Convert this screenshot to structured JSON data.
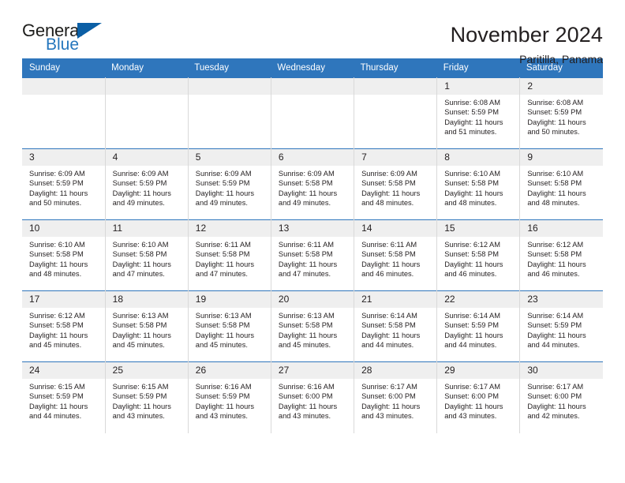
{
  "brand": {
    "name_part1": "General",
    "name_part2": "Blue",
    "triangle_color": "#0b5fa5",
    "blue_color": "#2476bd"
  },
  "header": {
    "title": "November 2024",
    "subtitle": "Paritilla, Panama"
  },
  "theme": {
    "header_bg": "#2f76bc",
    "daynum_bg": "#efefef",
    "text": "#231f20",
    "grid_line": "#d9d9d9"
  },
  "labels": {
    "sunrise_prefix": "Sunrise:",
    "sunset_prefix": "Sunset:",
    "daylight_prefix": "Daylight:"
  },
  "weekday_headers": [
    "Sunday",
    "Monday",
    "Tuesday",
    "Wednesday",
    "Thursday",
    "Friday",
    "Saturday"
  ],
  "weeks": [
    [
      {
        "day": "",
        "sunrise": "",
        "sunset": "",
        "daylight_line1": "",
        "daylight_line2": "",
        "empty": true
      },
      {
        "day": "",
        "sunrise": "",
        "sunset": "",
        "daylight_line1": "",
        "daylight_line2": "",
        "empty": true
      },
      {
        "day": "",
        "sunrise": "",
        "sunset": "",
        "daylight_line1": "",
        "daylight_line2": "",
        "empty": true
      },
      {
        "day": "",
        "sunrise": "",
        "sunset": "",
        "daylight_line1": "",
        "daylight_line2": "",
        "empty": true
      },
      {
        "day": "",
        "sunrise": "",
        "sunset": "",
        "daylight_line1": "",
        "daylight_line2": "",
        "empty": true
      },
      {
        "day": "1",
        "sunrise": "Sunrise: 6:08 AM",
        "sunset": "Sunset: 5:59 PM",
        "daylight_line1": "Daylight: 11 hours",
        "daylight_line2": "and 51 minutes.",
        "empty": false
      },
      {
        "day": "2",
        "sunrise": "Sunrise: 6:08 AM",
        "sunset": "Sunset: 5:59 PM",
        "daylight_line1": "Daylight: 11 hours",
        "daylight_line2": "and 50 minutes.",
        "empty": false
      }
    ],
    [
      {
        "day": "3",
        "sunrise": "Sunrise: 6:09 AM",
        "sunset": "Sunset: 5:59 PM",
        "daylight_line1": "Daylight: 11 hours",
        "daylight_line2": "and 50 minutes.",
        "empty": false
      },
      {
        "day": "4",
        "sunrise": "Sunrise: 6:09 AM",
        "sunset": "Sunset: 5:59 PM",
        "daylight_line1": "Daylight: 11 hours",
        "daylight_line2": "and 49 minutes.",
        "empty": false
      },
      {
        "day": "5",
        "sunrise": "Sunrise: 6:09 AM",
        "sunset": "Sunset: 5:59 PM",
        "daylight_line1": "Daylight: 11 hours",
        "daylight_line2": "and 49 minutes.",
        "empty": false
      },
      {
        "day": "6",
        "sunrise": "Sunrise: 6:09 AM",
        "sunset": "Sunset: 5:58 PM",
        "daylight_line1": "Daylight: 11 hours",
        "daylight_line2": "and 49 minutes.",
        "empty": false
      },
      {
        "day": "7",
        "sunrise": "Sunrise: 6:09 AM",
        "sunset": "Sunset: 5:58 PM",
        "daylight_line1": "Daylight: 11 hours",
        "daylight_line2": "and 48 minutes.",
        "empty": false
      },
      {
        "day": "8",
        "sunrise": "Sunrise: 6:10 AM",
        "sunset": "Sunset: 5:58 PM",
        "daylight_line1": "Daylight: 11 hours",
        "daylight_line2": "and 48 minutes.",
        "empty": false
      },
      {
        "day": "9",
        "sunrise": "Sunrise: 6:10 AM",
        "sunset": "Sunset: 5:58 PM",
        "daylight_line1": "Daylight: 11 hours",
        "daylight_line2": "and 48 minutes.",
        "empty": false
      }
    ],
    [
      {
        "day": "10",
        "sunrise": "Sunrise: 6:10 AM",
        "sunset": "Sunset: 5:58 PM",
        "daylight_line1": "Daylight: 11 hours",
        "daylight_line2": "and 48 minutes.",
        "empty": false
      },
      {
        "day": "11",
        "sunrise": "Sunrise: 6:10 AM",
        "sunset": "Sunset: 5:58 PM",
        "daylight_line1": "Daylight: 11 hours",
        "daylight_line2": "and 47 minutes.",
        "empty": false
      },
      {
        "day": "12",
        "sunrise": "Sunrise: 6:11 AM",
        "sunset": "Sunset: 5:58 PM",
        "daylight_line1": "Daylight: 11 hours",
        "daylight_line2": "and 47 minutes.",
        "empty": false
      },
      {
        "day": "13",
        "sunrise": "Sunrise: 6:11 AM",
        "sunset": "Sunset: 5:58 PM",
        "daylight_line1": "Daylight: 11 hours",
        "daylight_line2": "and 47 minutes.",
        "empty": false
      },
      {
        "day": "14",
        "sunrise": "Sunrise: 6:11 AM",
        "sunset": "Sunset: 5:58 PM",
        "daylight_line1": "Daylight: 11 hours",
        "daylight_line2": "and 46 minutes.",
        "empty": false
      },
      {
        "day": "15",
        "sunrise": "Sunrise: 6:12 AM",
        "sunset": "Sunset: 5:58 PM",
        "daylight_line1": "Daylight: 11 hours",
        "daylight_line2": "and 46 minutes.",
        "empty": false
      },
      {
        "day": "16",
        "sunrise": "Sunrise: 6:12 AM",
        "sunset": "Sunset: 5:58 PM",
        "daylight_line1": "Daylight: 11 hours",
        "daylight_line2": "and 46 minutes.",
        "empty": false
      }
    ],
    [
      {
        "day": "17",
        "sunrise": "Sunrise: 6:12 AM",
        "sunset": "Sunset: 5:58 PM",
        "daylight_line1": "Daylight: 11 hours",
        "daylight_line2": "and 45 minutes.",
        "empty": false
      },
      {
        "day": "18",
        "sunrise": "Sunrise: 6:13 AM",
        "sunset": "Sunset: 5:58 PM",
        "daylight_line1": "Daylight: 11 hours",
        "daylight_line2": "and 45 minutes.",
        "empty": false
      },
      {
        "day": "19",
        "sunrise": "Sunrise: 6:13 AM",
        "sunset": "Sunset: 5:58 PM",
        "daylight_line1": "Daylight: 11 hours",
        "daylight_line2": "and 45 minutes.",
        "empty": false
      },
      {
        "day": "20",
        "sunrise": "Sunrise: 6:13 AM",
        "sunset": "Sunset: 5:58 PM",
        "daylight_line1": "Daylight: 11 hours",
        "daylight_line2": "and 45 minutes.",
        "empty": false
      },
      {
        "day": "21",
        "sunrise": "Sunrise: 6:14 AM",
        "sunset": "Sunset: 5:58 PM",
        "daylight_line1": "Daylight: 11 hours",
        "daylight_line2": "and 44 minutes.",
        "empty": false
      },
      {
        "day": "22",
        "sunrise": "Sunrise: 6:14 AM",
        "sunset": "Sunset: 5:59 PM",
        "daylight_line1": "Daylight: 11 hours",
        "daylight_line2": "and 44 minutes.",
        "empty": false
      },
      {
        "day": "23",
        "sunrise": "Sunrise: 6:14 AM",
        "sunset": "Sunset: 5:59 PM",
        "daylight_line1": "Daylight: 11 hours",
        "daylight_line2": "and 44 minutes.",
        "empty": false
      }
    ],
    [
      {
        "day": "24",
        "sunrise": "Sunrise: 6:15 AM",
        "sunset": "Sunset: 5:59 PM",
        "daylight_line1": "Daylight: 11 hours",
        "daylight_line2": "and 44 minutes.",
        "empty": false
      },
      {
        "day": "25",
        "sunrise": "Sunrise: 6:15 AM",
        "sunset": "Sunset: 5:59 PM",
        "daylight_line1": "Daylight: 11 hours",
        "daylight_line2": "and 43 minutes.",
        "empty": false
      },
      {
        "day": "26",
        "sunrise": "Sunrise: 6:16 AM",
        "sunset": "Sunset: 5:59 PM",
        "daylight_line1": "Daylight: 11 hours",
        "daylight_line2": "and 43 minutes.",
        "empty": false
      },
      {
        "day": "27",
        "sunrise": "Sunrise: 6:16 AM",
        "sunset": "Sunset: 6:00 PM",
        "daylight_line1": "Daylight: 11 hours",
        "daylight_line2": "and 43 minutes.",
        "empty": false
      },
      {
        "day": "28",
        "sunrise": "Sunrise: 6:17 AM",
        "sunset": "Sunset: 6:00 PM",
        "daylight_line1": "Daylight: 11 hours",
        "daylight_line2": "and 43 minutes.",
        "empty": false
      },
      {
        "day": "29",
        "sunrise": "Sunrise: 6:17 AM",
        "sunset": "Sunset: 6:00 PM",
        "daylight_line1": "Daylight: 11 hours",
        "daylight_line2": "and 43 minutes.",
        "empty": false
      },
      {
        "day": "30",
        "sunrise": "Sunrise: 6:17 AM",
        "sunset": "Sunset: 6:00 PM",
        "daylight_line1": "Daylight: 11 hours",
        "daylight_line2": "and 42 minutes.",
        "empty": false
      }
    ]
  ]
}
